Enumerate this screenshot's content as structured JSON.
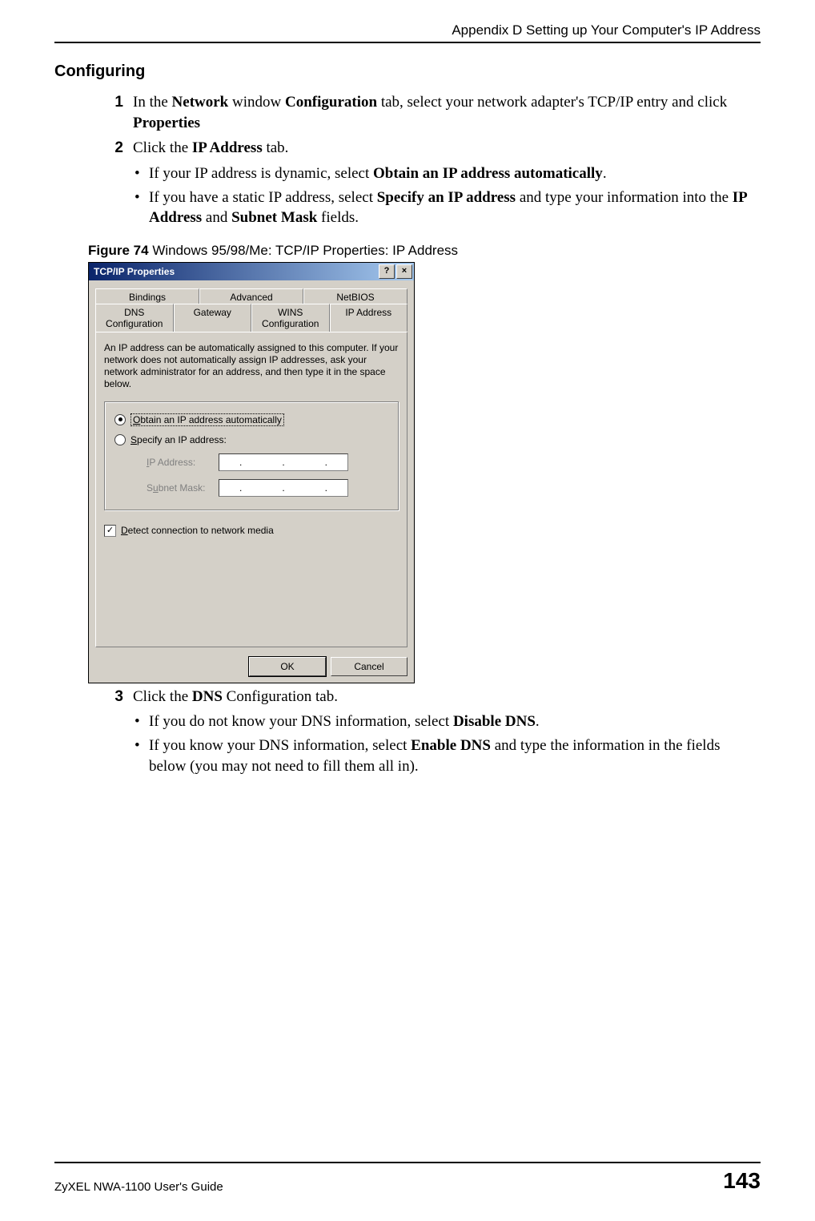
{
  "header": {
    "appendix": "Appendix D Setting up Your Computer's IP Address"
  },
  "section_title": "Configuring",
  "step1": {
    "num": "1",
    "t1": "In the ",
    "b1": "Network",
    "t2": " window ",
    "b2": "Configuration",
    "t3": " tab, select your network adapter's TCP/IP entry and click ",
    "b3": "Properties"
  },
  "step2": {
    "num": "2",
    "t1": "Click the ",
    "b1": "IP Address",
    "t2": " tab."
  },
  "step2_b1": {
    "t1": "If your IP address is dynamic, select ",
    "b1": "Obtain an IP address automatically",
    "t2": "."
  },
  "step2_b2": {
    "t1": "If you have a static IP address, select ",
    "b1": "Specify an IP address",
    "t2": " and type your information into the ",
    "b2": "IP Address",
    "t3": " and ",
    "b3": "Subnet Mask",
    "t4": " fields."
  },
  "figure": {
    "label": "Figure 74   ",
    "caption": "Windows 95/98/Me: TCP/IP Properties: IP Address"
  },
  "dialog": {
    "title": "TCP/IP Properties",
    "help_btn": "?",
    "close_btn": "×",
    "tabs_row1": [
      "Bindings",
      "Advanced",
      "NetBIOS"
    ],
    "tabs_row2": [
      "DNS Configuration",
      "Gateway",
      "WINS Configuration",
      "IP Address"
    ],
    "info": "An IP address can be automatically assigned to this computer. If your network does not automatically assign IP addresses, ask your network administrator for an address, and then type it in the space below.",
    "radio1_u": "O",
    "radio1_rest": "btain an IP address automatically",
    "radio2_u": "S",
    "radio2_rest": "pecify an IP address:",
    "ip_label_u": "I",
    "ip_label_rest": "P Address:",
    "subnet_label": "S",
    "subnet_label_u": "u",
    "subnet_label_rest": "bnet Mask:",
    "detect_u": "D",
    "detect_rest": "etect connection to network media",
    "check_mark": "✓",
    "ok": "OK",
    "cancel": "Cancel",
    "dot": "."
  },
  "step3": {
    "num": "3",
    "t1": "Click the ",
    "b1": "DNS",
    "t2": " Configuration tab."
  },
  "step3_b1": {
    "t1": "If you do not know your DNS information, select ",
    "b1": "Disable DNS",
    "t2": "."
  },
  "step3_b2": {
    "t1": "If you know your DNS information, select ",
    "b1": "Enable DNS",
    "t2": " and type the information in the fields below (you may not need to fill them all in)."
  },
  "footer": {
    "guide": "ZyXEL NWA-1100 User's Guide",
    "page": "143"
  }
}
